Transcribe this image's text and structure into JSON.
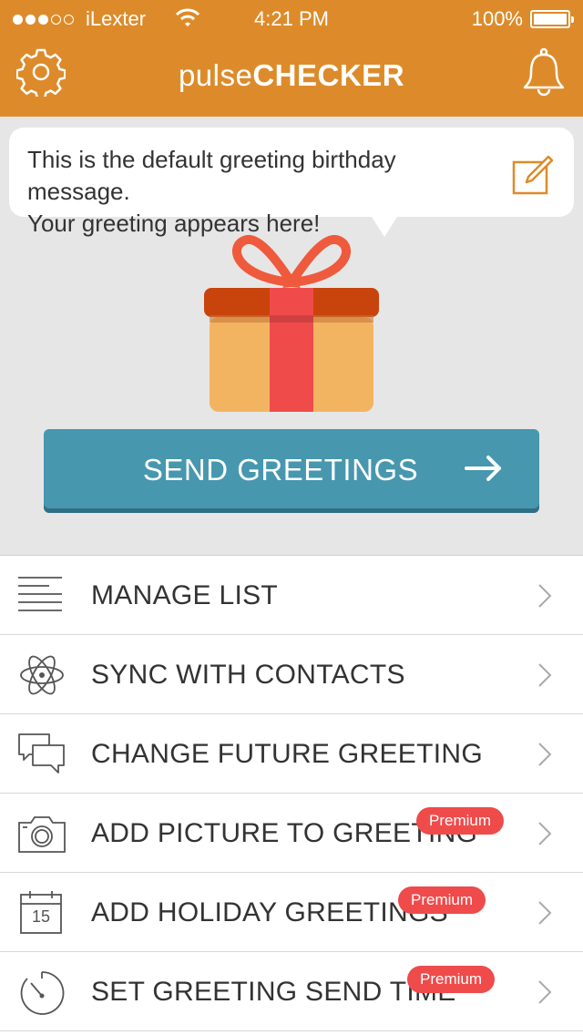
{
  "status_bar": {
    "carrier": "iLexter",
    "time": "4:21 PM",
    "battery": "100%",
    "signal_bars_filled": 3,
    "signal_bars_total": 5
  },
  "header": {
    "title_light": "pulse",
    "title_bold": "CHECKER",
    "color": "#dd8b2a"
  },
  "greeting": {
    "line1": "This is the default greeting birthday message.",
    "line2": "Your greeting appears here!"
  },
  "send_button": {
    "label": "SEND GREETINGS",
    "color": "#4797ae"
  },
  "menu": {
    "items": [
      {
        "label": "MANAGE LIST",
        "icon": "list-icon",
        "premium": ""
      },
      {
        "label": "SYNC WITH CONTACTS",
        "icon": "atom-icon",
        "premium": ""
      },
      {
        "label": "CHANGE FUTURE GREETING",
        "icon": "chat-bubbles-icon",
        "premium": ""
      },
      {
        "label": "ADD PICTURE TO GREETING",
        "icon": "camera-icon",
        "premium": "Premium"
      },
      {
        "label": "ADD HOLIDAY GREETINGS",
        "icon": "calendar-icon",
        "premium": "Premium",
        "calendar_day": "15"
      },
      {
        "label": "SET GREETING SEND TIME",
        "icon": "timer-icon",
        "premium": "Premium"
      }
    ]
  },
  "colors": {
    "premium_badge": "#ef4b4b",
    "gift_ribbon": "#ef4b4b",
    "gift_lid": "#c9430d",
    "gift_box": "#f3b462"
  }
}
